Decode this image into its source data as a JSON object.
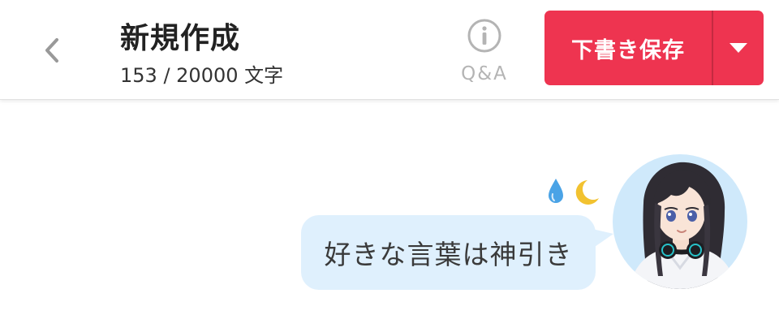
{
  "header": {
    "title": "新規作成",
    "counter": "153 / 20000 文字",
    "qa_label": "Q&A",
    "save_label": "下書き保存"
  },
  "message": {
    "text": "好きな言葉は神引き"
  },
  "icons": {
    "back": "chevron-left-icon",
    "qa": "info-circle-icon",
    "dropdown": "caret-down-icon",
    "emotes": [
      "droplet-icon",
      "crescent-moon-icon"
    ]
  },
  "colors": {
    "accent": "#ee3450",
    "bubble": "#dff0fd",
    "avatar_bg": "#cfe9fb",
    "muted": "#b4b4b4"
  }
}
